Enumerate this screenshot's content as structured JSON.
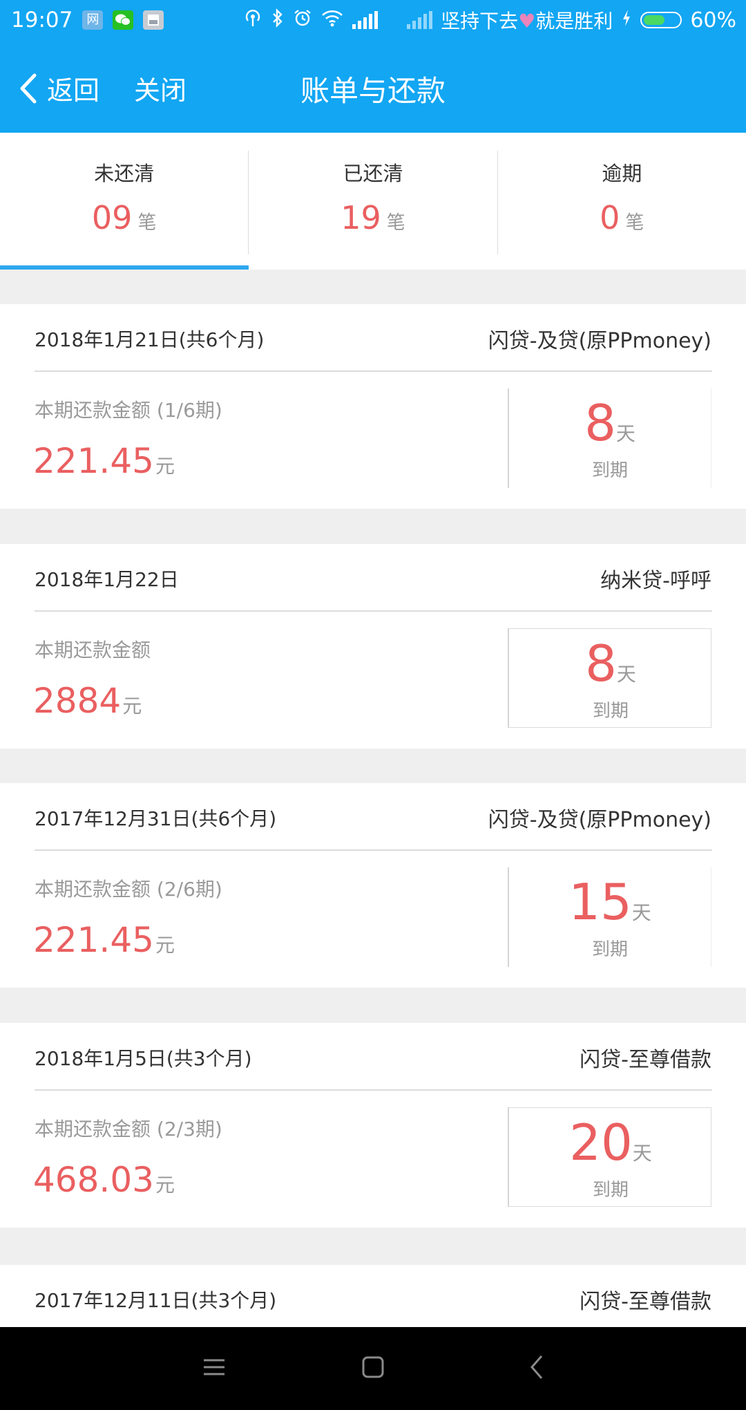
{
  "status_bar": {
    "time": "19:07",
    "app_icons": [
      "网",
      "wechat-icon",
      "gallery-icon"
    ],
    "carrier": "坚持下去",
    "carrier_suffix": "就是胜利",
    "battery": "60%",
    "battery_level": 0.6
  },
  "nav": {
    "back_label": "返回",
    "close_label": "关闭",
    "title": "账单与还款"
  },
  "tabs": [
    {
      "label": "未还清",
      "count": "09",
      "unit": "笔"
    },
    {
      "label": "已还清",
      "count": "19",
      "unit": "笔"
    },
    {
      "label": "逾期",
      "count": "0",
      "unit": "笔"
    }
  ],
  "bills": [
    {
      "date": "2018年1月21日(共6个月)",
      "lender": "闪贷-及贷(原PPmoney)",
      "amount_label": "本期还款金额 (1/6期)",
      "amount": "221.45",
      "currency": "元",
      "days": "8",
      "days_unit": "天",
      "due_label": "到期"
    },
    {
      "date": "2018年1月22日",
      "lender": "纳米贷-呼呼",
      "amount_label": "本期还款金额",
      "amount": "2884",
      "currency": "元",
      "days": "8",
      "days_unit": "天",
      "due_label": "到期"
    },
    {
      "date": "2017年12月31日(共6个月)",
      "lender": "闪贷-及贷(原PPmoney)",
      "amount_label": "本期还款金额 (2/6期)",
      "amount": "221.45",
      "currency": "元",
      "days": "15",
      "days_unit": "天",
      "due_label": "到期"
    },
    {
      "date": "2018年1月5日(共3个月)",
      "lender": "闪贷-至尊借款",
      "amount_label": "本期还款金额 (2/3期)",
      "amount": "468.03",
      "currency": "元",
      "days": "20",
      "days_unit": "天",
      "due_label": "到期"
    },
    {
      "date": "2017年12月11日(共3个月)",
      "lender": "闪贷-至尊借款"
    }
  ]
}
